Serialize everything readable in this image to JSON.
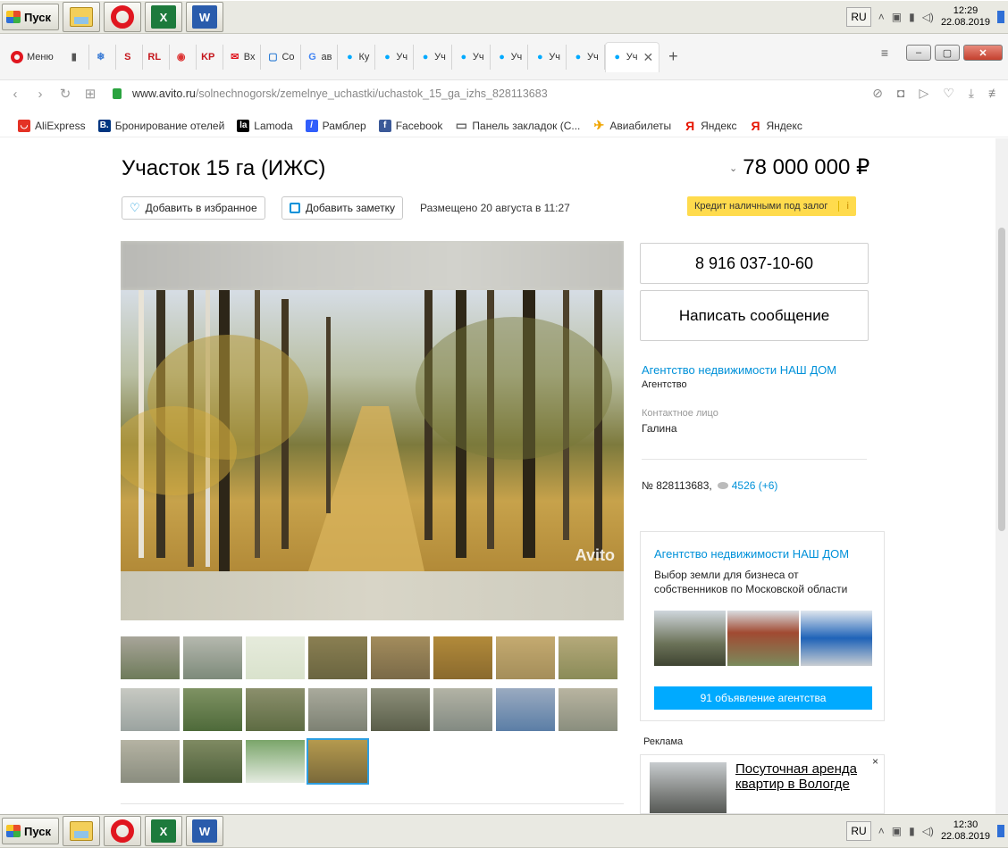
{
  "taskbar_top": {
    "start_label": "Пуск",
    "lang": "RU",
    "time": "12:29",
    "date": "22.08.2019",
    "excel_glyph": "X",
    "word_glyph": "W"
  },
  "taskbar_bottom": {
    "start_label": "Пуск",
    "lang": "RU",
    "time": "12:30",
    "date": "22.08.2019",
    "excel_glyph": "X",
    "word_glyph": "W"
  },
  "browser": {
    "menu_label": "Меню",
    "tabs": [
      {
        "label": "",
        "icon": "page-icon"
      },
      {
        "label": "",
        "icon": "snowflake-icon"
      },
      {
        "label": "",
        "icon": "s-icon"
      },
      {
        "label": "",
        "icon": "rl-icon"
      },
      {
        "label": "",
        "icon": "eye-circle-icon"
      },
      {
        "label": "",
        "icon": "kp-icon"
      },
      {
        "label": "Вх",
        "icon": "mail-icon"
      },
      {
        "label": "Co",
        "icon": "chat-icon"
      },
      {
        "label": "ав",
        "icon": "google-icon"
      },
      {
        "label": "Ку",
        "icon": "avito-icon"
      },
      {
        "label": "Уч",
        "icon": "avito-icon"
      },
      {
        "label": "Уч",
        "icon": "avito-icon"
      },
      {
        "label": "Уч",
        "icon": "avito-icon"
      },
      {
        "label": "Уч",
        "icon": "avito-icon"
      },
      {
        "label": "Уч",
        "icon": "avito-icon"
      },
      {
        "label": "Уч",
        "icon": "avito-icon"
      },
      {
        "label": "Уч",
        "icon": "avito-icon",
        "active": true
      }
    ],
    "url_domain": "www.avito.ru",
    "url_path": "/solnechnogorsk/zemelnye_uchastki/uchastok_15_ga_izhs_828113683"
  },
  "bookmarks": [
    {
      "label": "AliExpress",
      "icon": "aliexpress-icon",
      "color": "#e43225"
    },
    {
      "label": "Бронирование отелей",
      "icon": "booking-icon",
      "color": "#003580"
    },
    {
      "label": "Lamoda",
      "icon": "lamoda-icon",
      "color": "#000000"
    },
    {
      "label": "Рамблер",
      "icon": "rambler-icon",
      "color": "#315efb"
    },
    {
      "label": "Facebook",
      "icon": "facebook-icon",
      "color": "#3b5998"
    },
    {
      "label": "Панель закладок (С...",
      "icon": "folder-icon",
      "color": "#666666"
    },
    {
      "label": "Авиабилеты",
      "icon": "plane-icon",
      "color": "#f0a500"
    },
    {
      "label": "Яндекс",
      "icon": "yandex-icon",
      "color": "#e61400"
    },
    {
      "label": "Яндекс",
      "icon": "yandex-icon",
      "color": "#e61400"
    }
  ],
  "listing": {
    "title": "Участок 15 га (ИЖС)",
    "price": "78 000 000 ₽",
    "favorite_label": "Добавить в избранное",
    "note_label": "Добавить заметку",
    "posted": "Размещено 20 августа в 11:27",
    "credit_label": "Кредит наличными под залог",
    "credit_info": "i",
    "watermark": "Avito",
    "phone": "8 916 037-10-60",
    "message_label": "Написать сообщение",
    "agency_name": "Агентство недвижимости НАШ ДОМ",
    "agency_type": "Агентство",
    "contact_label": "Контактное лицо",
    "contact_name": "Галина",
    "listing_number": "№ 828113683,",
    "views": "4526 (+6)"
  },
  "agency_card": {
    "name": "Агентство недвижимости НАШ ДОМ",
    "description": "Выбор земли для бизнеса от собственников по Московской области",
    "cta": "91 объявление агентства"
  },
  "ad": {
    "label": "Реклама",
    "text": "Посуточная аренда квартир в Вологде",
    "close": "×"
  },
  "thumbnails": [
    {
      "colors": [
        "#6e7b5a",
        "#a8a59a"
      ]
    },
    {
      "colors": [
        "#7d8a7a",
        "#b5b8ae"
      ]
    },
    {
      "colors": [
        "#d9e2cc",
        "#e6ebdc"
      ]
    },
    {
      "colors": [
        "#6a6540",
        "#8a7f52"
      ]
    },
    {
      "colors": [
        "#7a6a48",
        "#a38c5c"
      ]
    },
    {
      "colors": [
        "#8a6a2e",
        "#b28a3a"
      ]
    },
    {
      "colors": [
        "#a48e5a",
        "#c4aa70"
      ]
    },
    {
      "colors": [
        "#8a8b58",
        "#b5a97a"
      ]
    },
    {
      "colors": [
        "#9ba3a0",
        "#c7c9c2"
      ]
    },
    {
      "colors": [
        "#4e6a3a",
        "#7f9263"
      ]
    },
    {
      "colors": [
        "#5e6c43",
        "#8b8f6c"
      ]
    },
    {
      "colors": [
        "#7d8173",
        "#a9aa9c"
      ]
    },
    {
      "colors": [
        "#5a5e4a",
        "#8d8f7a"
      ]
    },
    {
      "colors": [
        "#838a82",
        "#b3b3a5"
      ]
    },
    {
      "colors": [
        "#5b7ea6",
        "#9aaac0"
      ]
    },
    {
      "colors": [
        "#8a8e7e",
        "#b8b4a0"
      ]
    },
    {
      "colors": [
        "#8a8d7f",
        "#b5b3a3"
      ]
    },
    {
      "colors": [
        "#4d5f3a",
        "#7f8a62"
      ]
    },
    {
      "colors": [
        "#e4ebe0",
        "#7aa56a"
      ]
    },
    {
      "colors": [
        "#7a6a3a",
        "#b59a4e"
      ]
    }
  ]
}
